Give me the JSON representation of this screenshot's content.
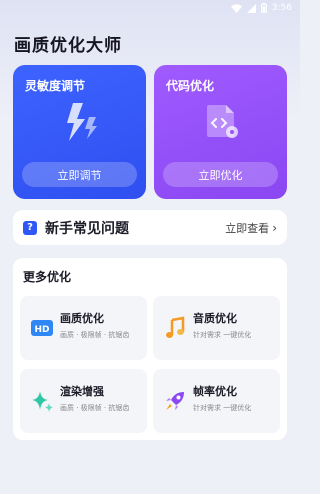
{
  "status_bar": {
    "time": "3:56"
  },
  "app": {
    "title": "画质优化大师"
  },
  "cards": [
    {
      "title": "灵敏度调节",
      "button": "立即调节"
    },
    {
      "title": "代码优化",
      "button": "立即优化"
    }
  ],
  "faq": {
    "label": "新手常见问题",
    "link": "立即查看"
  },
  "more": {
    "title": "更多优化",
    "tiles": [
      {
        "name": "画质优化",
        "desc": "画质 · 极限帧 · 抗锯齿"
      },
      {
        "name": "音质优化",
        "desc": "针对需求 一键优化"
      },
      {
        "name": "渲染增强",
        "desc": "画质 · 极限帧 · 抗锯齿"
      },
      {
        "name": "帧率优化",
        "desc": "针对需求 一键优化"
      }
    ]
  },
  "colors": {
    "accent_blue": "#2f57f5",
    "accent_purple": "#9a55fb"
  }
}
